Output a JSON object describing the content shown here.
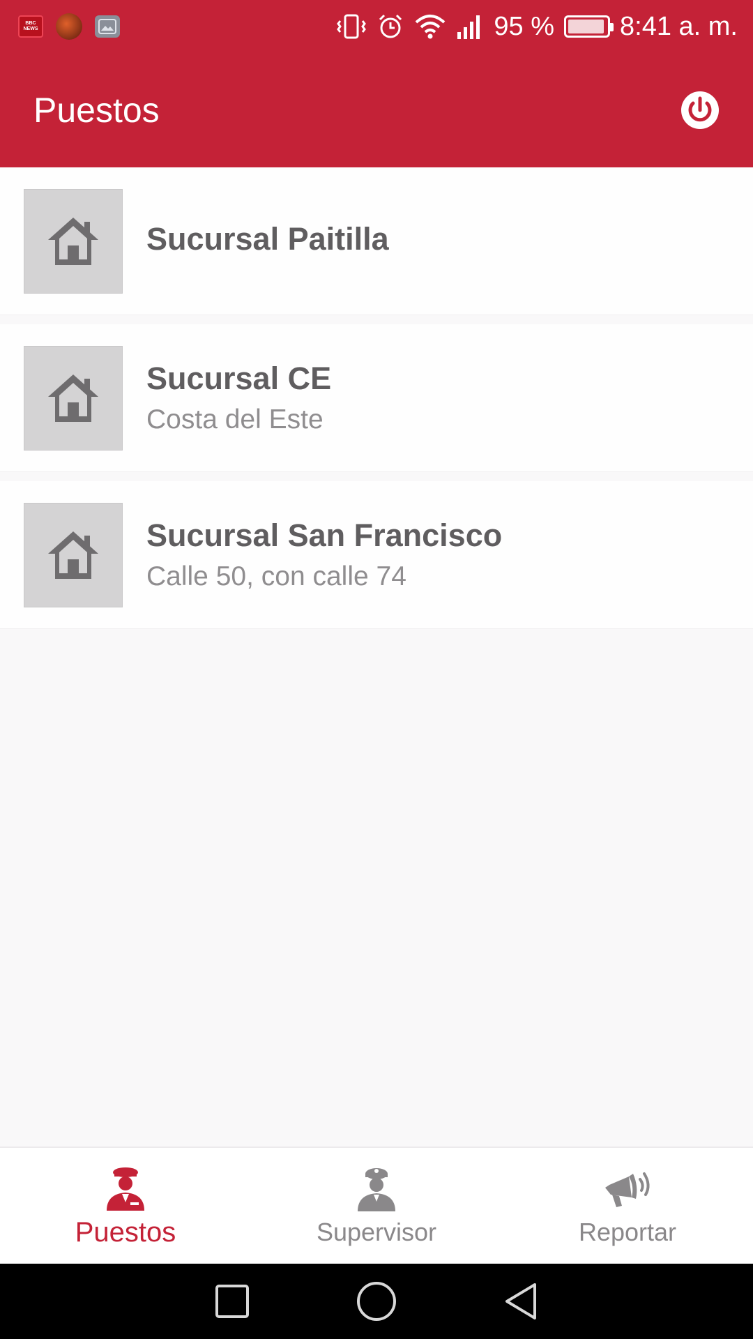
{
  "status_bar": {
    "battery_percent": "95 %",
    "battery_level": 0.95,
    "time": "8:41 a. m.",
    "notification_icons": [
      "bbc-news-icon",
      "avatar-notification-icon",
      "gallery-icon"
    ],
    "bbc_text": "BBC NEWS",
    "system_icons": [
      "vibrate-icon",
      "alarm-icon",
      "wifi-icon",
      "signal-icon",
      "battery-icon"
    ]
  },
  "app_bar": {
    "title": "Puestos",
    "action_icon": "power-icon"
  },
  "list": {
    "items": [
      {
        "title": "Sucursal Paitilla",
        "subtitle": "",
        "icon": "home-icon"
      },
      {
        "title": "Sucursal CE",
        "subtitle": "Costa del Este",
        "icon": "home-icon"
      },
      {
        "title": "Sucursal San Francisco",
        "subtitle": "Calle 50, con calle 74",
        "icon": "home-icon"
      }
    ]
  },
  "bottom_nav": {
    "items": [
      {
        "label": "Puestos",
        "icon": "guard-icon",
        "active": true
      },
      {
        "label": "Supervisor",
        "icon": "supervisor-icon",
        "active": false
      },
      {
        "label": "Reportar",
        "icon": "megaphone-icon",
        "active": false
      }
    ]
  },
  "system_nav": {
    "buttons": [
      "recents-icon",
      "home-circle-icon",
      "back-triangle-icon"
    ]
  },
  "colors": {
    "primary": "#c42237",
    "text_dark": "#5f5d5f",
    "text_muted": "#8f8d8f",
    "thumb_bg": "#d4d3d4",
    "nav_inactive": "#8a888a"
  }
}
